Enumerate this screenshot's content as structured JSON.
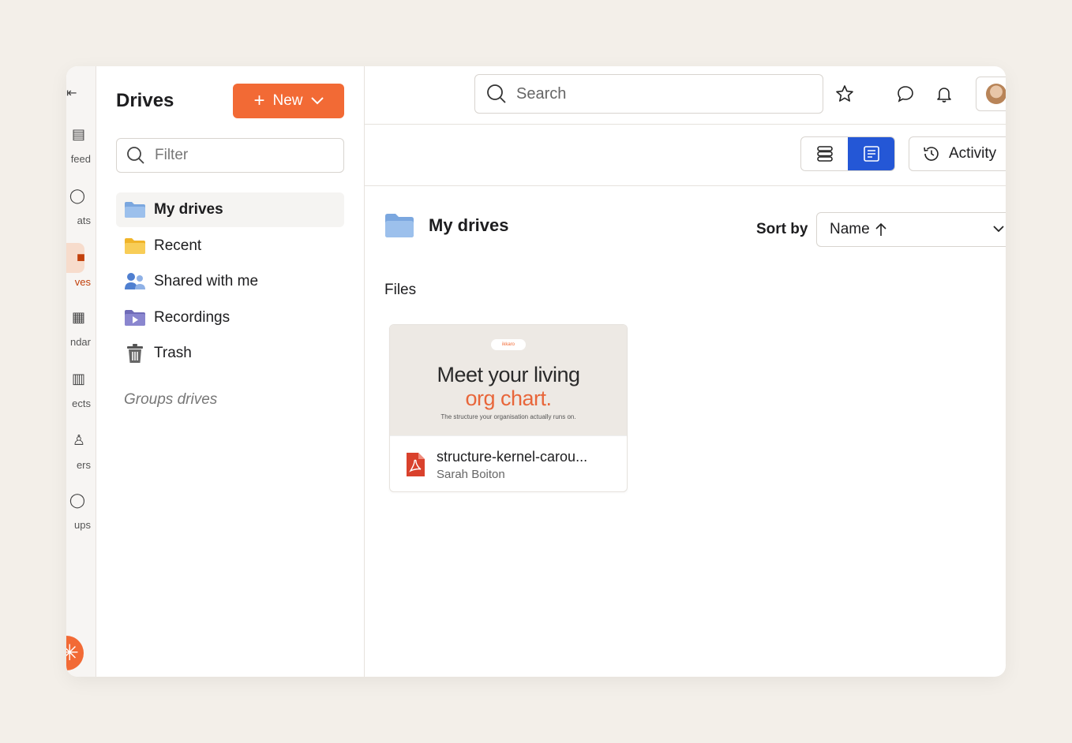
{
  "rail": {
    "items": [
      {
        "label": "feed",
        "icon": "news-icon"
      },
      {
        "label": "ats",
        "icon": "chat-icon"
      },
      {
        "label": "ves",
        "icon": "drive-icon"
      },
      {
        "label": "ndar",
        "icon": "calendar-icon"
      },
      {
        "label": "ects",
        "icon": "projects-icon"
      },
      {
        "label": "ers",
        "icon": "users-icon"
      },
      {
        "label": "ups",
        "icon": "groups-icon"
      }
    ],
    "active_color": "#c2410c"
  },
  "panel": {
    "title": "Drives",
    "new_label": "New",
    "filter_placeholder": "Filter",
    "nav": [
      {
        "label": "My drives",
        "icon": "blue-folder-icon"
      },
      {
        "label": "Recent",
        "icon": "yellow-folder-icon"
      },
      {
        "label": "Shared with me",
        "icon": "people-icon"
      },
      {
        "label": "Recordings",
        "icon": "video-folder-icon"
      },
      {
        "label": "Trash",
        "icon": "trash-icon"
      }
    ],
    "groups_label": "Groups drives"
  },
  "topbar": {
    "search_placeholder": "Search"
  },
  "toolbar": {
    "activity_label": "Activity"
  },
  "content": {
    "title": "My drives",
    "sort_label": "Sort by",
    "sort_value": "Name",
    "files_label": "Files",
    "files": [
      {
        "name": "structure-kernel-carou...",
        "owner": "Sarah Boiton",
        "thumb_line1": "Meet your living",
        "thumb_line2": "org chart.",
        "thumb_line3": "The structure your organisation actually runs on.",
        "thumb_pill": "ikkaro"
      }
    ]
  },
  "colors": {
    "accent": "#f26a35",
    "primary_blue": "#2457d6",
    "folder_blue": "#7ba7df",
    "folder_yellow": "#f5c443"
  }
}
